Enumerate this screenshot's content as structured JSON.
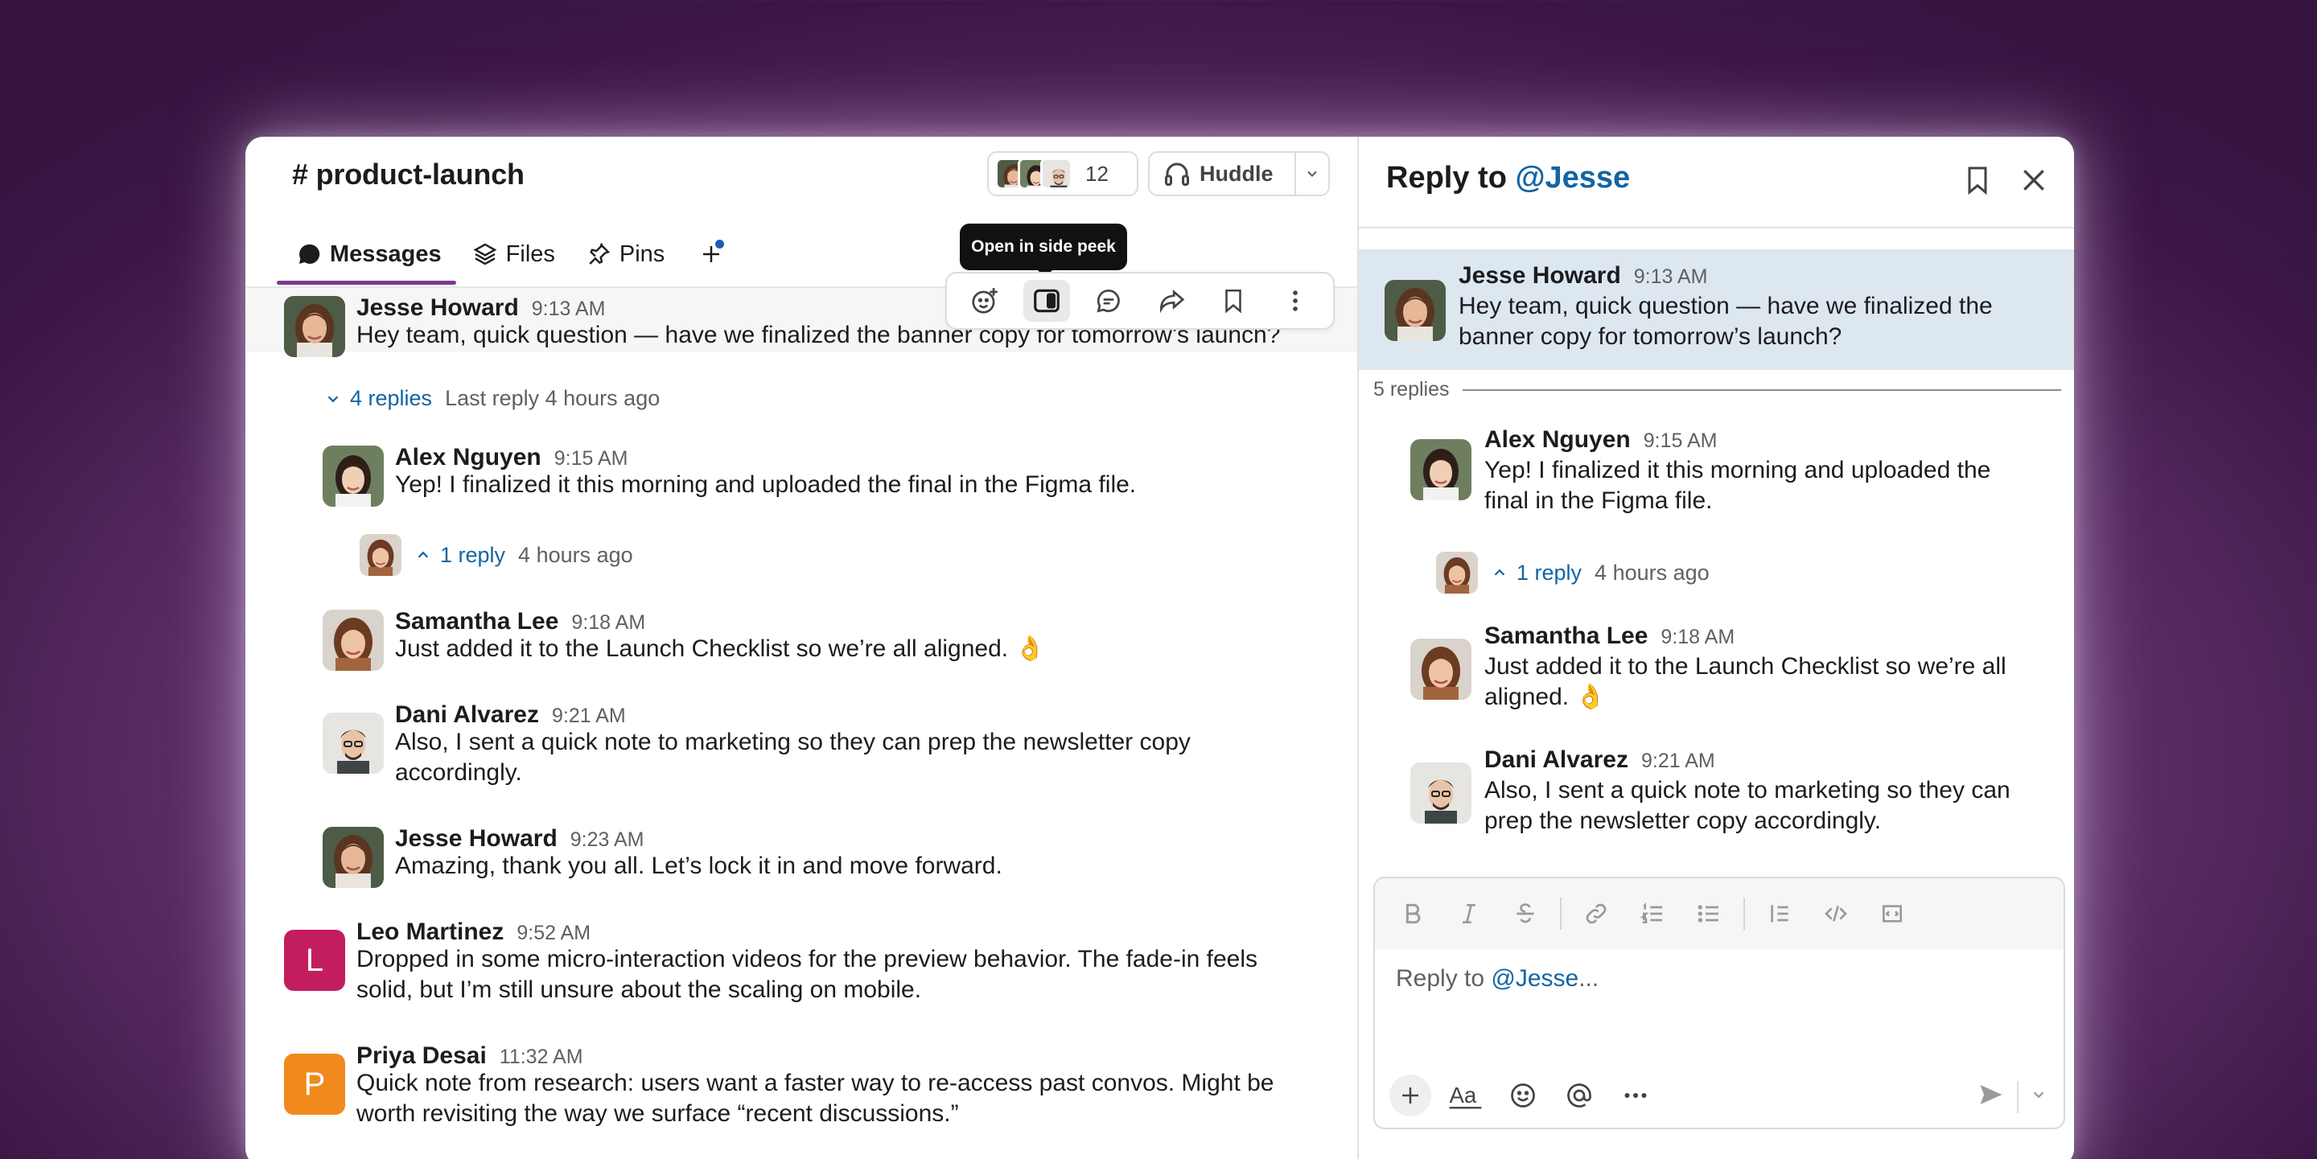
{
  "channel": {
    "name": "# product-launch",
    "member_count": "12"
  },
  "huddle": {
    "label": "Huddle"
  },
  "tabs": [
    {
      "label": "Messages",
      "icon": "message-bubble-icon",
      "active": true
    },
    {
      "label": "Files",
      "icon": "layers-icon"
    },
    {
      "label": "Pins",
      "icon": "pin-icon"
    }
  ],
  "hover_toolbar": {
    "tooltip": "Open in side peek",
    "actions": [
      "add-reaction-icon",
      "side-peek-icon",
      "reply-in-thread-icon",
      "share-icon",
      "bookmark-icon",
      "more-icon"
    ]
  },
  "messages": [
    {
      "name": "Jesse Howard",
      "time": "9:13 AM",
      "text": "Hey team, quick question — have we finalized the banner copy for tomorrow’s launch?"
    },
    {
      "name": "Alex Nguyen",
      "time": "9:15 AM",
      "text": "Yep! I finalized it this morning and uploaded the final in the Figma file."
    },
    {
      "name": "Samantha Lee",
      "time": "9:18 AM",
      "text": "Just added it to the Launch Checklist so we’re all aligned. 👌"
    },
    {
      "name": "Dani Alvarez",
      "time": "9:21 AM",
      "text1": "Also, I sent a quick note to marketing so they can prep the newsletter copy",
      "text2": "accordingly."
    },
    {
      "name": "Jesse Howard",
      "time": "9:23 AM",
      "text": "Amazing, thank you all. Let’s lock it in and move forward."
    },
    {
      "name": "Leo Martinez",
      "time": "9:52 AM",
      "initial": "L",
      "color": "#c21e5d",
      "text1": "Dropped in some micro-interaction videos for the preview behavior. The fade-in feels",
      "text2": "solid, but I’m still unsure about the scaling on mobile."
    },
    {
      "name": "Priya Desai",
      "time": "11:32 AM",
      "initial": "P",
      "color": "#f08a1c",
      "text1": "Quick note from research: users want a faster way to re-access past convos. Might be",
      "text2": "worth revisiting the way we surface “recent discussions.”"
    }
  ],
  "thread_summary": {
    "replies": "4 replies",
    "last": "Last reply 4 hours ago"
  },
  "sub_thread": {
    "replies": "1 reply",
    "ago": "4 hours ago"
  },
  "side_panel": {
    "title_prefix": "Reply to ",
    "title_user": "@Jesse",
    "parent": {
      "name": "Jesse Howard",
      "time": "9:13 AM",
      "line1": "Hey team, quick question — have we finalized the",
      "line2": "banner copy for tomorrow’s launch?"
    },
    "replies_count": "5 replies",
    "replies": [
      {
        "name": "Alex Nguyen",
        "time": "9:15 AM",
        "line1": "Yep! I finalized it this morning and uploaded the",
        "line2": "final in the Figma file."
      },
      {
        "name": "Samantha Lee",
        "time": "9:18 AM",
        "line1": "Just added it to the Launch Checklist so we’re all",
        "line2": "aligned. 👌"
      },
      {
        "name": "Dani Alvarez",
        "time": "9:21 AM",
        "line1": "Also, I sent a quick note to marketing so they can",
        "line2": "prep the newsletter copy accordingly."
      }
    ],
    "composer": {
      "placeholder_prefix": "Reply to ",
      "placeholder_user": "@Jesse",
      "placeholder_suffix": "...",
      "format_tools": [
        "bold-icon",
        "italic-icon",
        "strikethrough-icon",
        "link-icon",
        "numbered-list-icon",
        "bulleted-list-icon",
        "blockquote-icon",
        "code-icon",
        "code-block-icon"
      ],
      "actions": [
        "plus-icon",
        "text-format-icon",
        "emoji-icon",
        "mention-icon",
        "more-icon"
      ]
    }
  },
  "colors": {
    "accent_purple": "#7c3a8e",
    "link_blue": "#1264a3",
    "thread_highlight": "#dde7f0"
  }
}
